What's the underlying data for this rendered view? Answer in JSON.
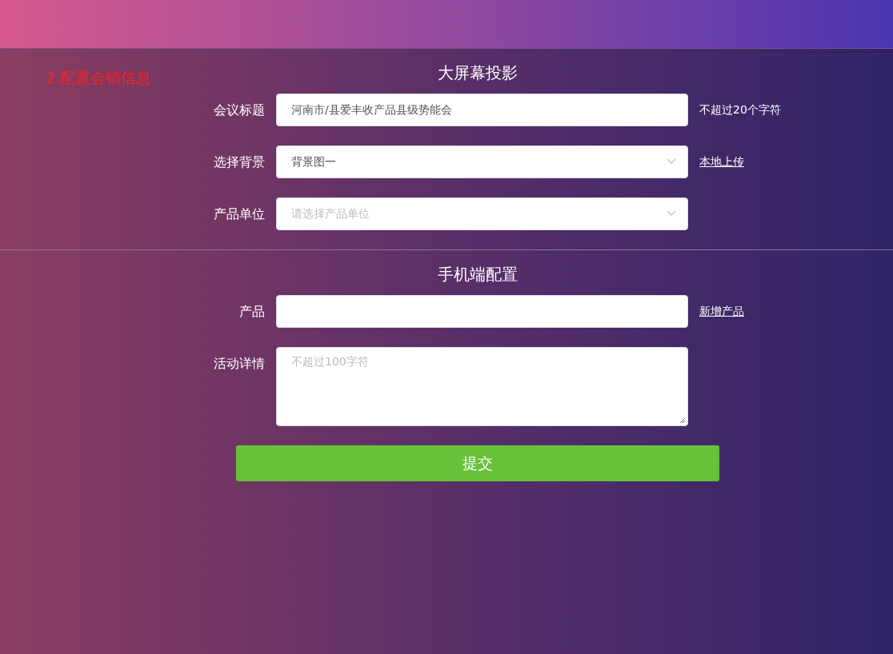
{
  "step_label": "2.配置会销信息",
  "sections": [
    {
      "title": "大屏幕投影",
      "fields": [
        {
          "kind": "text",
          "label": "会议标题",
          "value": "河南市/县爱丰收产品县级势能会",
          "aside": {
            "kind": "note",
            "text": "不超过20个字符"
          }
        },
        {
          "kind": "select",
          "label": "选择背景",
          "value": "背景图一",
          "aside": {
            "kind": "link",
            "text": "本地上传"
          }
        },
        {
          "kind": "select",
          "label": "产品单位",
          "placeholder": "请选择产品单位"
        }
      ]
    },
    {
      "title": "手机端配置",
      "fields": [
        {
          "kind": "text",
          "label": "产品",
          "aside": {
            "kind": "link",
            "text": "新增产品"
          }
        },
        {
          "kind": "textarea",
          "label": "活动详情",
          "placeholder": "不超过100字符"
        }
      ]
    }
  ],
  "submit": "提交"
}
